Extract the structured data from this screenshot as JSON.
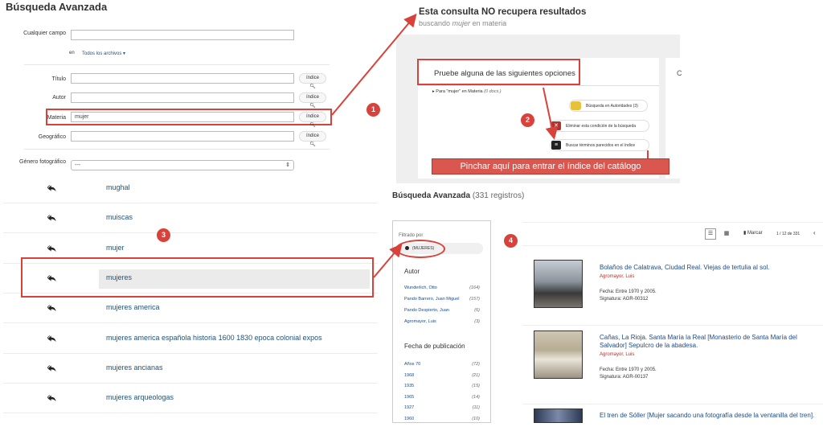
{
  "form": {
    "title": "Búsqueda Avanzada",
    "any_field_label": "Cualquier campo",
    "in_label": "en",
    "archive_select": "Todos los archivos",
    "fields": [
      {
        "label": "Título",
        "value": "",
        "button": "índice"
      },
      {
        "label": "Autor",
        "value": "",
        "button": "índice"
      },
      {
        "label": "Materia",
        "value": "mujer",
        "button": "índice"
      },
      {
        "label": "Geográfico",
        "value": "",
        "button": "índice"
      }
    ],
    "genre_label": "Género fotográfico",
    "genre_value": "---"
  },
  "index_list": [
    {
      "label": "mughal"
    },
    {
      "label": "muiscas"
    },
    {
      "label": "mujer"
    },
    {
      "label": "mujeres"
    },
    {
      "label": "mujeres america"
    },
    {
      "label": "mujeres america española historia 1600 1830 epoca colonial expos"
    },
    {
      "label": "mujeres ancianas"
    },
    {
      "label": "mujeres arqueologas"
    }
  ],
  "no_results": {
    "title": "Esta consulta NO recupera resultados",
    "subtitle_pre": "buscando ",
    "subtitle_term": "mujer",
    "subtitle_post": " en materia",
    "suggest_title": "Pruebe alguna de las siguientes opciones",
    "para_line_pre": "Para \"mujer\" en ",
    "para_line_field": "Materia",
    "para_line_count": "(0 docs.)",
    "opt1": "Búsqueda en Autoridades (3)",
    "opt2": "Eliminar esta condición de la búsqueda",
    "opt3": "Buscar términos parecidos en el índice",
    "banner": "Pinchar aquí para entrar el índice del catálogo",
    "right_fragment": "C"
  },
  "badges": [
    "1",
    "2",
    "3",
    "4"
  ],
  "results": {
    "title": "Búsqueda Avanzada",
    "count": "(331 registros)",
    "filter_label": "Filtrado por",
    "filter_chip": "(MUJERES)",
    "facet_author_title": "Autor",
    "authors": [
      {
        "name": "Wunderlich, Otto",
        "count": "(164)"
      },
      {
        "name": "Pando Barrero, Juan Miguel",
        "count": "(157)"
      },
      {
        "name": "Pando Despierto, Juan",
        "count": "(6)"
      },
      {
        "name": "Agromayor, Luis",
        "count": "(3)"
      }
    ],
    "facet_date_title": "Fecha de publicación",
    "dates": [
      {
        "name": "Años 70",
        "count": "(72)"
      },
      {
        "name": "1968",
        "count": "(21)"
      },
      {
        "name": "1935",
        "count": "(15)"
      },
      {
        "name": "1965",
        "count": "(14)"
      },
      {
        "name": "1927",
        "count": "(11)"
      },
      {
        "name": "1960",
        "count": "(10)"
      }
    ],
    "toolbar_mark": "Marcar",
    "pagination": "1 / 12 de 331",
    "records": [
      {
        "title": "Bolaños de Calatrava, Ciudad Real. Viejas de tertulia al sol.",
        "author": "Agromayor, Luis",
        "date": "Fecha: Entre 1970 y 2005.",
        "signature": "Signatura: AGR-00312"
      },
      {
        "title": "Cañas, La Rioja. Santa María la Real [Monasterio de Santa María del Salvador] Sepulcro de la abadesa.",
        "author": "Agromayor, Luis",
        "date": "Fecha: Entre 1970 y 2005.",
        "signature": "Signatura: AGR-00137"
      },
      {
        "title": "El tren de Sóller [Mujer sacando una fotografía desde la ventanilla del tren].",
        "author": "",
        "date": "",
        "signature": ""
      }
    ]
  },
  "colors": {
    "accent_red": "#d9423a",
    "link_blue": "#23527c",
    "banner": "#d9574e"
  }
}
